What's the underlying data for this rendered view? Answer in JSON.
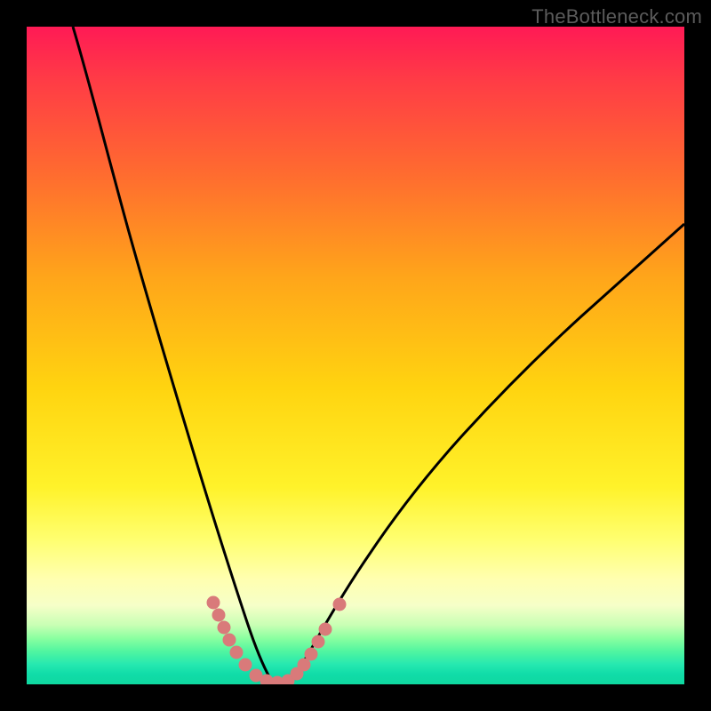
{
  "watermark": "TheBottleneck.com",
  "chart_data": {
    "type": "line",
    "title": "",
    "xlabel": "",
    "ylabel": "",
    "xlim": [
      0,
      100
    ],
    "ylim": [
      0,
      100
    ],
    "gradient_stops": [
      {
        "pos": 0,
        "color": "#ff1a55"
      },
      {
        "pos": 8,
        "color": "#ff3b46"
      },
      {
        "pos": 22,
        "color": "#ff6a30"
      },
      {
        "pos": 38,
        "color": "#ffa51a"
      },
      {
        "pos": 55,
        "color": "#ffd410"
      },
      {
        "pos": 70,
        "color": "#fff22a"
      },
      {
        "pos": 78,
        "color": "#ffff70"
      },
      {
        "pos": 84,
        "color": "#ffffb0"
      },
      {
        "pos": 88,
        "color": "#f6ffc8"
      },
      {
        "pos": 91,
        "color": "#c8ffb4"
      },
      {
        "pos": 93,
        "color": "#8affa0"
      },
      {
        "pos": 95,
        "color": "#50f5a0"
      },
      {
        "pos": 97,
        "color": "#25e8b0"
      },
      {
        "pos": 98.5,
        "color": "#10dca8"
      },
      {
        "pos": 100,
        "color": "#0fd8a0"
      }
    ],
    "series": [
      {
        "name": "bottleneck-curve",
        "stroke": "#000000",
        "stroke_width": 3,
        "points": [
          {
            "x": 7.0,
            "y": 100.0
          },
          {
            "x": 9.0,
            "y": 88.0
          },
          {
            "x": 11.0,
            "y": 76.0
          },
          {
            "x": 13.0,
            "y": 65.0
          },
          {
            "x": 15.0,
            "y": 55.0
          },
          {
            "x": 17.0,
            "y": 46.0
          },
          {
            "x": 19.0,
            "y": 37.5
          },
          {
            "x": 21.0,
            "y": 30.0
          },
          {
            "x": 23.0,
            "y": 23.5
          },
          {
            "x": 25.0,
            "y": 17.7
          },
          {
            "x": 27.0,
            "y": 12.6
          },
          {
            "x": 29.0,
            "y": 8.3
          },
          {
            "x": 31.0,
            "y": 4.8
          },
          {
            "x": 33.0,
            "y": 2.3
          },
          {
            "x": 35.0,
            "y": 0.6
          },
          {
            "x": 37.0,
            "y": 0.0
          },
          {
            "x": 39.0,
            "y": 0.3
          },
          {
            "x": 41.0,
            "y": 1.4
          },
          {
            "x": 43.0,
            "y": 3.2
          },
          {
            "x": 45.0,
            "y": 5.3
          },
          {
            "x": 48.0,
            "y": 9.0
          },
          {
            "x": 52.0,
            "y": 14.5
          },
          {
            "x": 56.0,
            "y": 20.0
          },
          {
            "x": 60.0,
            "y": 25.5
          },
          {
            "x": 65.0,
            "y": 32.0
          },
          {
            "x": 70.0,
            "y": 38.5
          },
          {
            "x": 76.0,
            "y": 46.0
          },
          {
            "x": 82.0,
            "y": 53.0
          },
          {
            "x": 88.0,
            "y": 60.0
          },
          {
            "x": 94.0,
            "y": 67.0
          },
          {
            "x": 100.0,
            "y": 73.0
          }
        ]
      },
      {
        "name": "salmon-markers",
        "stroke": "#d97a7a",
        "stroke_width": 12,
        "marker_radius": 7,
        "points": [
          {
            "x": 28.5,
            "y": 12.5
          },
          {
            "x": 29.5,
            "y": 10.0
          },
          {
            "x": 30.5,
            "y": 7.5
          },
          {
            "x": 31.5,
            "y": 5.0
          },
          {
            "x": 33.0,
            "y": 2.5
          },
          {
            "x": 35.0,
            "y": 0.6
          },
          {
            "x": 37.0,
            "y": 0.2
          },
          {
            "x": 39.0,
            "y": 0.4
          },
          {
            "x": 41.0,
            "y": 1.5
          },
          {
            "x": 42.5,
            "y": 3.0
          },
          {
            "x": 44.0,
            "y": 5.0
          },
          {
            "x": 45.0,
            "y": 7.0
          },
          {
            "x": 46.0,
            "y": 9.5
          },
          {
            "x": 48.5,
            "y": 13.0
          }
        ]
      }
    ]
  }
}
